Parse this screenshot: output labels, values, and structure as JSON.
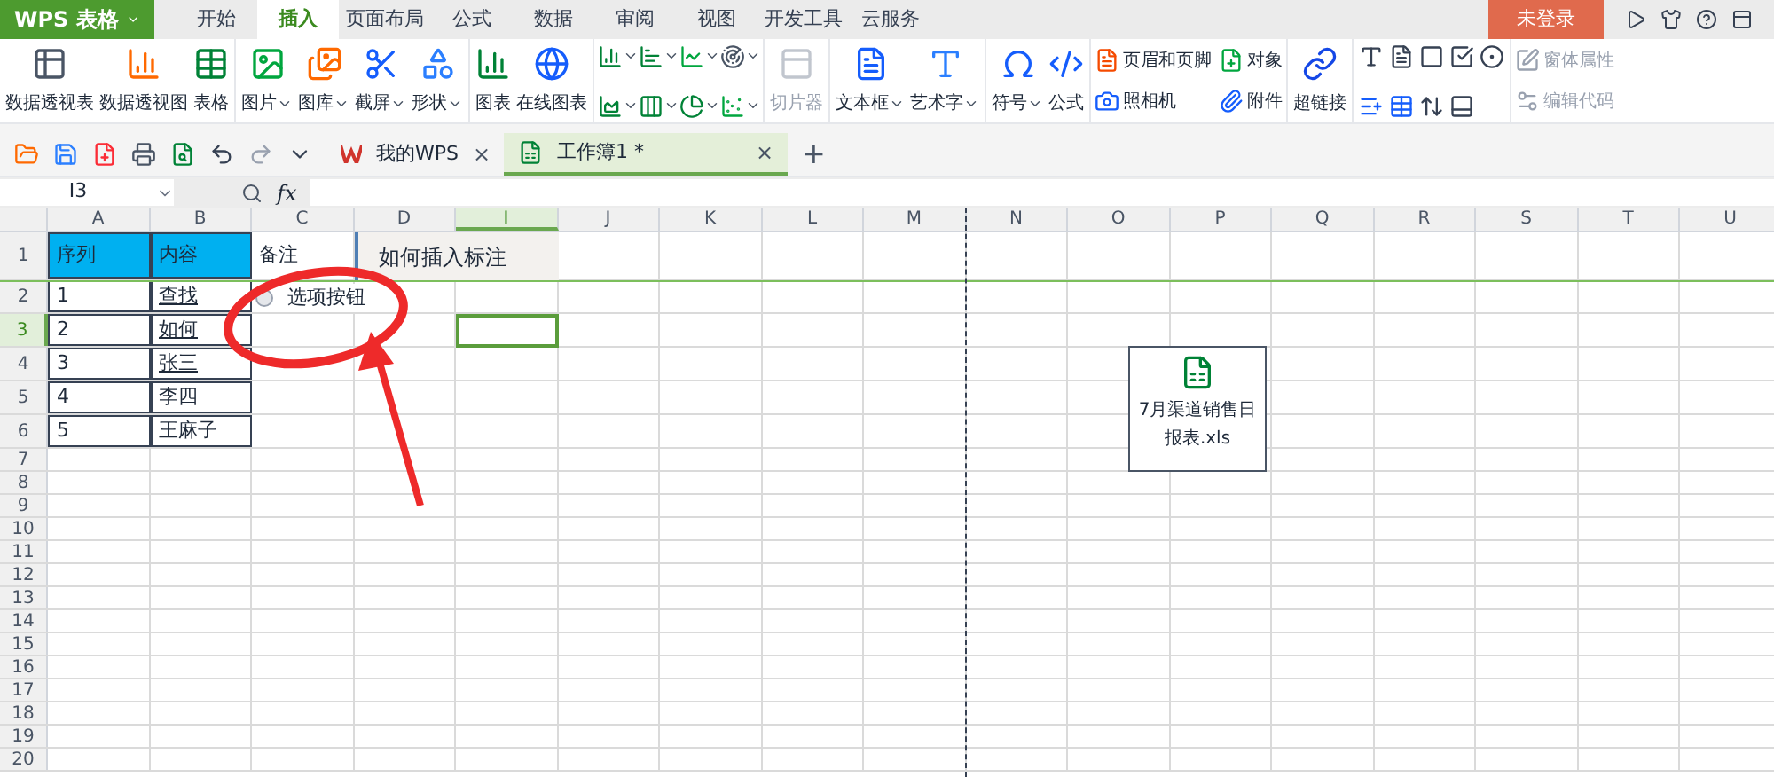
{
  "app_menu": {
    "label": "WPS 表格"
  },
  "menu_tabs": [
    {
      "label": "开始",
      "selected": false
    },
    {
      "label": "插入",
      "selected": true
    },
    {
      "label": "页面布局",
      "selected": false
    },
    {
      "label": "公式",
      "selected": false
    },
    {
      "label": "数据",
      "selected": false
    },
    {
      "label": "审阅",
      "selected": false
    },
    {
      "label": "视图",
      "selected": false
    },
    {
      "label": "开发工具",
      "selected": false
    },
    {
      "label": "云服务",
      "selected": false
    }
  ],
  "login_button": "未登录",
  "ribbon": [
    {
      "kind": "large",
      "items": [
        {
          "label": "数据透视表",
          "dropdown": false,
          "disabled": false
        },
        {
          "label": "数据透视图",
          "dropdown": false,
          "disabled": false
        },
        {
          "label": "表格",
          "dropdown": false,
          "disabled": false
        }
      ]
    },
    {
      "kind": "large",
      "items": [
        {
          "label": "图片",
          "dropdown": true,
          "disabled": false
        },
        {
          "label": "图库",
          "dropdown": true,
          "disabled": false
        },
        {
          "label": "截屏",
          "dropdown": true,
          "disabled": false
        },
        {
          "label": "形状",
          "dropdown": true,
          "disabled": false
        }
      ]
    },
    {
      "kind": "large",
      "items": [
        {
          "label": "图表",
          "dropdown": false,
          "disabled": false
        },
        {
          "label": "在线图表",
          "dropdown": false,
          "disabled": false
        }
      ]
    },
    {
      "kind": "chart-icons"
    },
    {
      "kind": "large",
      "items": [
        {
          "label": "切片器",
          "dropdown": false,
          "disabled": true
        }
      ]
    },
    {
      "kind": "large",
      "items": [
        {
          "label": "文本框",
          "dropdown": true,
          "disabled": false
        },
        {
          "label": "艺术字",
          "dropdown": true,
          "disabled": false
        }
      ]
    },
    {
      "kind": "large",
      "items": [
        {
          "label": "符号",
          "dropdown": true,
          "disabled": false
        },
        {
          "label": "公式",
          "dropdown": false,
          "disabled": false
        }
      ]
    },
    {
      "kind": "small",
      "items": [
        {
          "label": "页眉和页脚",
          "disabled": false
        },
        {
          "label": "照相机",
          "disabled": false
        },
        {
          "label": "对象",
          "disabled": false
        },
        {
          "label": "附件",
          "disabled": false
        }
      ]
    },
    {
      "kind": "large",
      "items": [
        {
          "label": "超链接",
          "dropdown": false,
          "disabled": false
        }
      ]
    },
    {
      "kind": "control-icons"
    },
    {
      "kind": "small",
      "items": [
        {
          "label": "窗体属性",
          "disabled": true
        },
        {
          "label": "编辑代码",
          "disabled": true
        }
      ]
    }
  ],
  "doc_tabs": [
    {
      "label": "我的WPS",
      "selected": false,
      "close": "×"
    },
    {
      "label": "工作簿1 *",
      "selected": true,
      "close": "×"
    }
  ],
  "new_tab": "+",
  "formula_bar": {
    "name_box": "I3",
    "fx": "fx"
  },
  "columns": [
    {
      "label": "A",
      "selected": false
    },
    {
      "label": "B",
      "selected": false
    },
    {
      "label": "C",
      "selected": false
    },
    {
      "label": "D",
      "selected": false
    },
    {
      "label": "I",
      "selected": true
    },
    {
      "label": "J",
      "selected": false
    },
    {
      "label": "K",
      "selected": false
    },
    {
      "label": "L",
      "selected": false
    },
    {
      "label": "M",
      "selected": false
    },
    {
      "label": "N",
      "selected": false
    },
    {
      "label": "O",
      "selected": false
    },
    {
      "label": "P",
      "selected": false
    },
    {
      "label": "Q",
      "selected": false
    },
    {
      "label": "R",
      "selected": false
    },
    {
      "label": "S",
      "selected": false
    },
    {
      "label": "T",
      "selected": false
    },
    {
      "label": "U",
      "selected": false
    }
  ],
  "rows": [
    {
      "label": "1",
      "selected": false,
      "cells": [
        {
          "text": "序列",
          "link": false
        },
        {
          "text": "内容",
          "link": false
        },
        {
          "text": "备注",
          "link": false
        }
      ]
    },
    {
      "label": "2",
      "selected": false,
      "cells": [
        {
          "text": "1",
          "link": false
        },
        {
          "text": "查找",
          "link": true
        }
      ]
    },
    {
      "label": "3",
      "selected": true,
      "cells": [
        {
          "text": "2",
          "link": false
        },
        {
          "text": "如何",
          "link": true
        }
      ]
    },
    {
      "label": "4",
      "selected": false,
      "cells": [
        {
          "text": "3",
          "link": false
        },
        {
          "text": "张三",
          "link": true
        }
      ]
    },
    {
      "label": "5",
      "selected": false,
      "cells": [
        {
          "text": "4",
          "link": false
        },
        {
          "text": "李四",
          "link": false
        }
      ]
    },
    {
      "label": "6",
      "selected": false,
      "cells": [
        {
          "text": "5",
          "link": false
        },
        {
          "text": "王麻子",
          "link": false
        }
      ]
    },
    {
      "label": "7",
      "selected": false,
      "cells": []
    },
    {
      "label": "8",
      "selected": false,
      "cells": []
    },
    {
      "label": "9",
      "selected": false,
      "cells": []
    },
    {
      "label": "10",
      "selected": false,
      "cells": []
    },
    {
      "label": "11",
      "selected": false,
      "cells": []
    },
    {
      "label": "12",
      "selected": false,
      "cells": []
    },
    {
      "label": "13",
      "selected": false,
      "cells": []
    },
    {
      "label": "14",
      "selected": false,
      "cells": []
    },
    {
      "label": "15",
      "selected": false,
      "cells": []
    },
    {
      "label": "16",
      "selected": false,
      "cells": []
    },
    {
      "label": "17",
      "selected": false,
      "cells": []
    },
    {
      "label": "18",
      "selected": false,
      "cells": []
    },
    {
      "label": "19",
      "selected": false,
      "cells": []
    },
    {
      "label": "20",
      "selected": false,
      "cells": []
    }
  ],
  "option_button": {
    "label": "选项按钮",
    "checked": false
  },
  "callout": {
    "text": "如何插入标注"
  },
  "embedded_file": {
    "name": "7月渠道销售日报表.xls"
  }
}
